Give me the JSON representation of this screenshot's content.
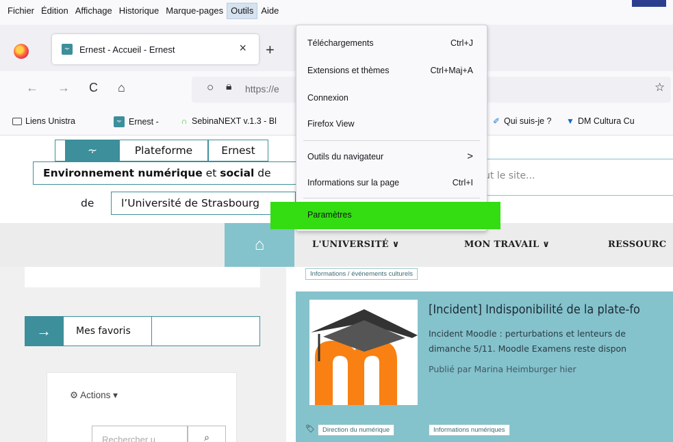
{
  "menubar": {
    "items": [
      "Fichier",
      "Édition",
      "Affichage",
      "Historique",
      "Marque-pages",
      "Outils",
      "Aide"
    ],
    "active": "Outils"
  },
  "tab": {
    "favicon": "ernest-favicon",
    "title": "Ernest - Accueil - Ernest",
    "close": "×",
    "new_tab": "+"
  },
  "nav": {
    "back": "←",
    "forward": "→",
    "reload": "C",
    "home": "⌂",
    "url": "https://e"
  },
  "bookmarks": [
    {
      "label": "Liens Unistra",
      "icon": "folder-icon"
    },
    {
      "label": "Ernest -",
      "icon": "ernest-favicon"
    },
    {
      "label": "SebinaNEXT v.1.3 - Bl",
      "icon": "sebina-icon"
    },
    {
      "label": "Qui suis-je ?",
      "icon": "quill-icon"
    },
    {
      "label": "DM Cultura Cu",
      "icon": "dm-icon"
    }
  ],
  "site": {
    "logo": {
      "plateforme": "Plateforme",
      "ernest": "Ernest",
      "env_bold1": "Environnement numérique",
      "env_mid": " et ",
      "env_bold2": "social",
      "env_de": " de",
      "de": "de",
      "universite": "l’Université de Strasbourg"
    },
    "search_placeholder": "ut le site...",
    "topnav": [
      "L'UNIVERSITÉ ∨",
      "MON TRAVAIL ∨",
      "RESSOURC"
    ],
    "tag_top": "Informations / événements culturels",
    "favoris": "Mes favoris",
    "actions": "Actions ▾",
    "search_left_placeholder": "Rechercher u",
    "news": {
      "title": "[Incident] Indisponibilité de la plate-fo",
      "body_line1": "Incident Moodle : perturbations et lenteurs de",
      "body_line2": "dimanche 5/11. Moodle Examens reste dispon",
      "meta": "Publié par Marina Heimburger hier",
      "tags": [
        "Direction du numérique",
        "Informations numériques"
      ]
    }
  },
  "menu": {
    "items": [
      {
        "label": "Téléchargements",
        "shortcut": "Ctrl+J"
      },
      {
        "label": "Extensions et thèmes",
        "shortcut": "Ctrl+Maj+A"
      },
      {
        "label": "Connexion",
        "shortcut": ""
      },
      {
        "label": "Firefox View",
        "shortcut": ""
      },
      {
        "label": "Outils du navigateur",
        "shortcut": ">"
      },
      {
        "label": "Informations sur la page",
        "shortcut": "Ctrl+I"
      },
      {
        "label": "Paramètres",
        "shortcut": ""
      }
    ],
    "highlight_color": "#33dd11"
  },
  "colors": {
    "teal": "#3c8f9b",
    "light_teal": "#84c2cc",
    "accent_blue": "#2b3f8e"
  }
}
